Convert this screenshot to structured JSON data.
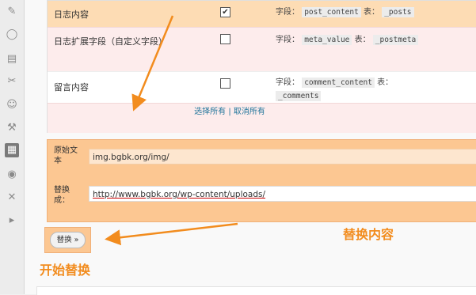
{
  "sidebar": {
    "icons": [
      "pin-icon",
      "comment-bubble-icon",
      "page-icon",
      "plugin-icon",
      "users-icon",
      "tools-icon",
      "active-tool-icon",
      "wordpress-icon",
      "settings-icon",
      "collapse-icon"
    ]
  },
  "table": {
    "rows": [
      {
        "name": "日志内容",
        "checked": true,
        "field_label": "字段：",
        "field": "post_content",
        "table_label": "表：",
        "table": "_posts"
      },
      {
        "name": "日志扩展字段（自定义字段）",
        "checked": false,
        "field_label": "字段：",
        "field": "meta_value",
        "table_label": "表：",
        "table": "_postmeta"
      },
      {
        "name": "留言内容",
        "checked": false,
        "field_label": "字段：",
        "field": "comment_content",
        "table_label": "表：",
        "table": "_comments"
      }
    ],
    "select_all": "选择所有",
    "separator": "|",
    "deselect_all": "取消所有"
  },
  "replace_form": {
    "original_label": "原始文本",
    "original_value": "img.bgbk.org/img/",
    "replace_label": "替换成：",
    "replace_value": "http://www.bgbk.org/wp-content/uploads/"
  },
  "button": {
    "label": "替换 »"
  },
  "annotations": {
    "replace_content": "替换内容",
    "start_replace": "开始替换"
  },
  "colors": {
    "accent": "#f28c1e",
    "highlight": "#fcc792"
  }
}
